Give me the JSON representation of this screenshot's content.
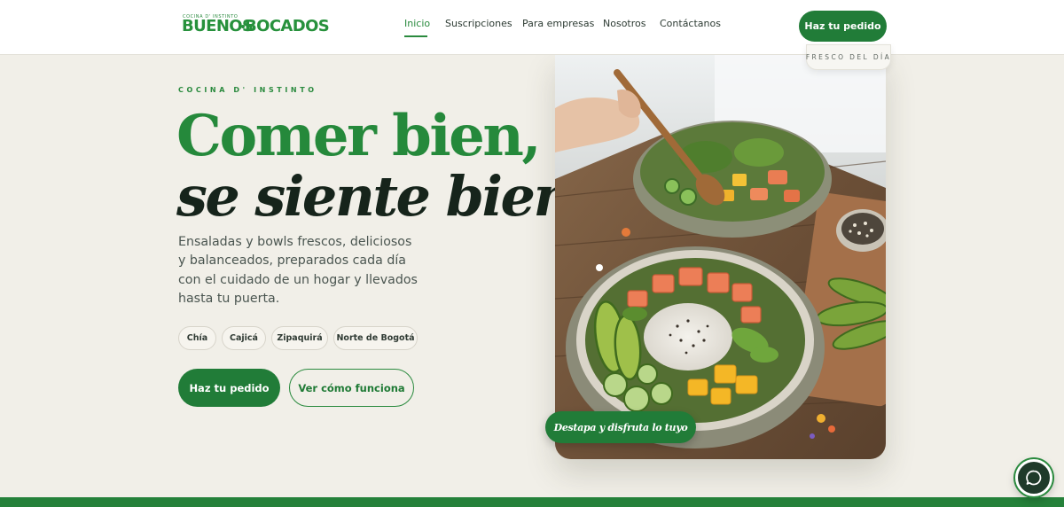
{
  "header": {
    "logo": {
      "tagline": "Cocina d' instinto",
      "word1": "BUENOS",
      "word2": "BOCADOS"
    },
    "nav": [
      {
        "label": "Inicio",
        "active": true
      },
      {
        "label": "Suscripciones",
        "active": false
      },
      {
        "label": "Para empresas",
        "active": false
      },
      {
        "label": "Nosotros",
        "active": false
      },
      {
        "label": "Contáctanos",
        "active": false
      }
    ],
    "cta_label": "Haz tu pedido"
  },
  "hero": {
    "eyebrow": "COCINA D' INSTINTO",
    "headline_line1": "Comer bien,",
    "headline_line2": "se siente bien.",
    "description": "Ensaladas y bowls frescos, deliciosos y balanceados, preparados cada día con el cuidado de un hogar y llevados hasta tu puerta.",
    "locations": [
      "Chía",
      "Cajicá",
      "Zipaquirá",
      "Norte de Bogotá"
    ],
    "primary_button": "Haz tu pedido",
    "secondary_button": "Ver cómo funciona",
    "image_badge": "FRESCO DEL DÍA",
    "image_caption": "Destapa y disfruta lo tuyo"
  },
  "colors": {
    "brand_green": "#217c38",
    "accent_green": "#2a8a3e",
    "background": "#f1efe8",
    "dark_text": "#16241b"
  },
  "icons": {
    "chat": "chat-bubble-icon"
  }
}
